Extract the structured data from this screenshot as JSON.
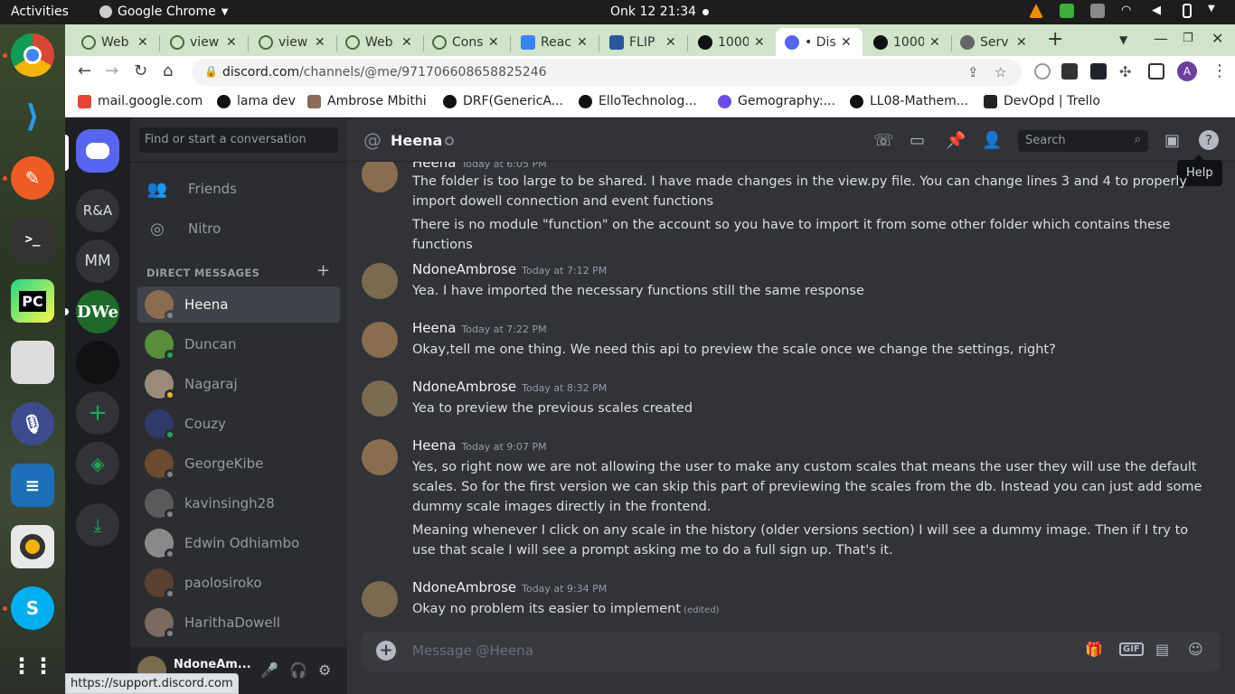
{
  "topbar": {
    "activities": "Activities",
    "app_name": "Google Chrome",
    "clock": "Onk 12  21:34"
  },
  "tabs": [
    {
      "label": "Web",
      "favicon": "generic-icon",
      "color": "#4a6a3a"
    },
    {
      "label": "view",
      "favicon": "generic-icon",
      "color": "#4a6a3a"
    },
    {
      "label": "view",
      "favicon": "generic-icon",
      "color": "#4a6a3a"
    },
    {
      "label": "Web",
      "favicon": "generic-icon",
      "color": "#4a6a3a"
    },
    {
      "label": "Cons",
      "favicon": "generic-icon",
      "color": "#4a6a3a"
    },
    {
      "label": "Reac",
      "favicon": "react-icon",
      "color": "#3b82f6"
    },
    {
      "label": "FLIP",
      "favicon": "word-icon",
      "color": "#2b579a"
    },
    {
      "label": "1000",
      "favicon": "github-icon",
      "color": "#111"
    },
    {
      "label": "• Dis",
      "favicon": "discord-icon",
      "color": "#5865f2",
      "active": true
    },
    {
      "label": "1000",
      "favicon": "github-icon",
      "color": "#111"
    },
    {
      "label": "Serv",
      "favicon": "globe-icon",
      "color": "#666"
    }
  ],
  "omnibox": {
    "host": "discord.com",
    "path": "/channels/@me/971706608658825246"
  },
  "bookmarks": [
    {
      "label": "mail.google.com",
      "color": "#ea4335"
    },
    {
      "label": "lama dev",
      "color": "#111"
    },
    {
      "label": "Ambrose Mbithi",
      "color": "#8a6a5a"
    },
    {
      "label": "DRF(GenericA...",
      "color": "#111"
    },
    {
      "label": "ElloTechnolog...",
      "color": "#111"
    },
    {
      "label": "Gemography:...",
      "color": "#6b4de6"
    },
    {
      "label": "LL08-Mathem...",
      "color": "#111"
    },
    {
      "label": "DevOpd | Trello",
      "color": "#222"
    }
  ],
  "guilds": [
    {
      "label": "R&A"
    },
    {
      "label": "MM"
    },
    {
      "label": "DWe"
    }
  ],
  "dm": {
    "search_placeholder": "Find or start a conversation",
    "friends": "Friends",
    "nitro": "Nitro",
    "header": "DIRECT MESSAGES",
    "items": [
      {
        "name": "Heena",
        "status": "offline",
        "color": "#8a6d4e"
      },
      {
        "name": "Duncan",
        "status": "online",
        "color": "#5a8d3a"
      },
      {
        "name": "Nagaraj",
        "status": "idle",
        "color": "#9a8a7a"
      },
      {
        "name": "Couzy",
        "status": "online",
        "color": "#2e3a6a"
      },
      {
        "name": "GeorgeKibe",
        "status": "offline",
        "color": "#6a4a30"
      },
      {
        "name": "kavinsingh28",
        "status": "offline",
        "color": "#5a5a5a"
      },
      {
        "name": "Edwin Odhiambo",
        "status": "offline",
        "color": "#8a8a8a"
      },
      {
        "name": "paolosiroko",
        "status": "offline",
        "color": "#5a4030"
      },
      {
        "name": "HarithaDowell",
        "status": "offline",
        "color": "#7a6a60"
      }
    ],
    "user": "NdoneAm...",
    "status_colors": {
      "online": "#23a559",
      "idle": "#f0b232",
      "offline": "#80848e"
    }
  },
  "status_link": "https://support.discord.com",
  "chat": {
    "title": "Heena",
    "search": "Search",
    "tooltip": "Help",
    "messages": [
      {
        "author": "Heena",
        "time": "Today at 6:05 PM",
        "lines": [
          "The folder is too large to be shared. I have made changes in the view.py file. You can change lines 3 and 4 to properly import dowell connection and event functions",
          "There is no module \"function\" on the account so you have to import it from some other folder which contains these functions"
        ]
      },
      {
        "author": "NdoneAmbrose",
        "time": "Today at 7:12 PM",
        "lines": [
          "Yea. I have imported the necessary functions still the same response"
        ]
      },
      {
        "author": "Heena",
        "time": "Today at 7:22 PM",
        "lines": [
          "Okay,tell me one thing. We need this api to preview the scale once we change the settings, right?"
        ]
      },
      {
        "author": "NdoneAmbrose",
        "time": "Today at 8:32 PM",
        "lines": [
          "Yea to preview the previous scales created"
        ]
      },
      {
        "author": "Heena",
        "time": "Today at 9:07 PM",
        "lines": [
          "Yes, so right now we are not allowing the user to make any custom scales that means the user they will use the default scales. So for the first version we can skip this part of previewing the scales from the db. Instead you can just add some dummy scale images directly in the frontend.",
          "Meaning whenever I click on any scale in the history (older versions section) I will see a dummy image. Then if I try to use that scale I will see a prompt asking me to do a full sign up. That's it."
        ]
      },
      {
        "author": "NdoneAmbrose",
        "time": "Today at 9:34 PM",
        "lines": [
          "Okay no problem its easier to implement"
        ],
        "edited": "(edited)"
      }
    ],
    "composer_placeholder": "Message @Heena",
    "gif_label": "GIF"
  }
}
